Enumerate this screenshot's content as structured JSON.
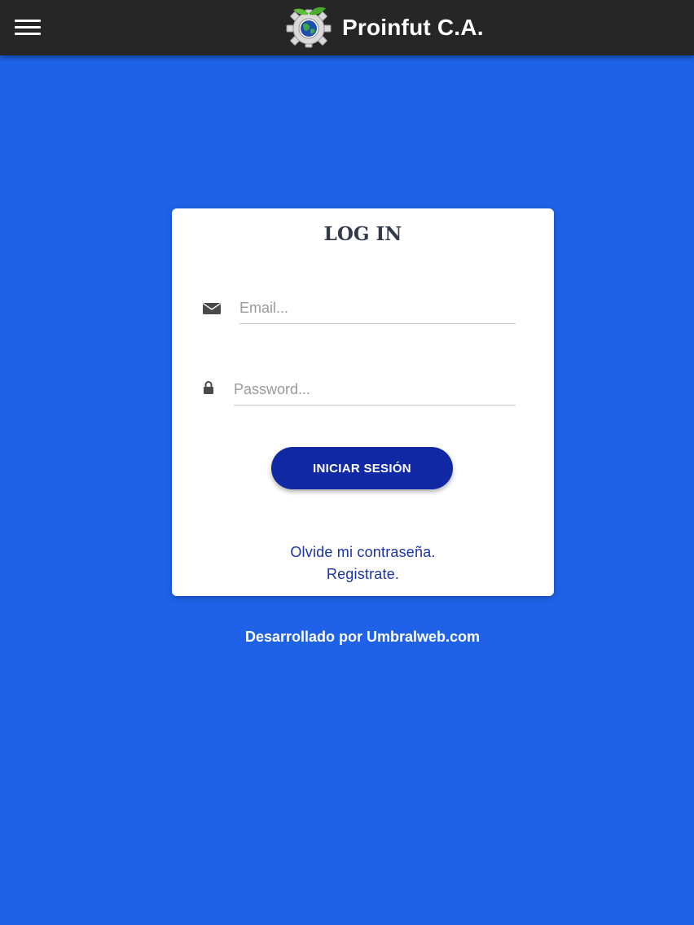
{
  "appbar": {
    "title": "Proinfut C.A.",
    "menu_icon": "hamburger-menu-icon",
    "logo_icon": "gear-globe-logo-icon"
  },
  "login": {
    "title": "LOG IN",
    "email_placeholder": "Email...",
    "email_value": "",
    "email_icon": "envelope-icon",
    "password_placeholder": "Password...",
    "password_value": "",
    "password_icon": "lock-icon",
    "submit_label": "INICIAR SESIÓN",
    "forgot_label": "Olvide mi contraseña.",
    "register_label": "Registrate."
  },
  "footer": {
    "text": "Desarrollado por Umbralweb.com"
  },
  "colors": {
    "background": "#1f62e8",
    "appbar": "#262626",
    "button": "#1229a6",
    "link": "#1a33a8"
  }
}
